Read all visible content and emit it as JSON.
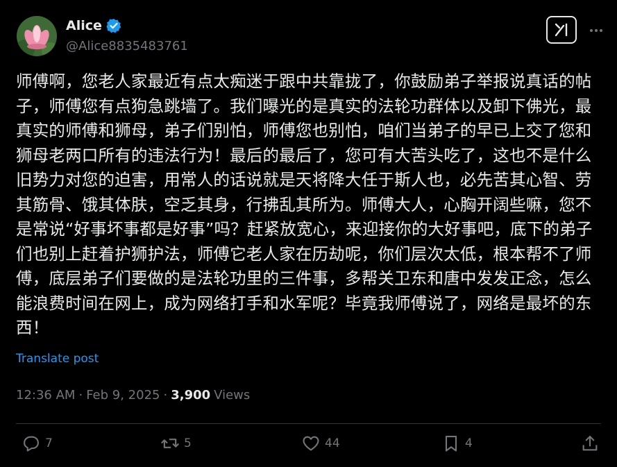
{
  "author": {
    "name": "Alice",
    "handle": "@Alice8835483761",
    "verified": true
  },
  "post": {
    "text": "师傅啊，您老人家最近有点太痴迷于跟中共靠拢了，你鼓励弟子举报说真话的帖子，师傅您有点狗急跳墙了。我们曝光的是真实的法轮功群体以及卸下佛光，最真实的师傅和狮母，弟子们别怕，师傅您也别怕，咱们当弟子的早已上交了您和狮母老两口所有的违法行为！最后的最后了，您可有大苦头吃了，这也不是什么旧势力对您的迫害，用常人的话说就是天将降大任于斯人也，必先苦其心智、劳其筋骨、饿其体肤，空乏其身，行拂乱其所为。师傅大人，心胸开阔些嘛，您不是常说“好事坏事都是好事”吗？赶紧放宽心，来迎接你的大好事吧，底下的弟子们也别上赶着护狮护法，师傅它老人家在历劫呢，你们层次太低，根本帮不了师傅，底层弟子们要做的是法轮功里的三件事，多帮关卫东和唐中发发正念，怎么能浪费时间在网上，成为网络打手和水军呢？毕竟我师傅说了，网络是最坏的东西！",
    "translate_label": "Translate post",
    "time": "12:36 AM",
    "separator": "·",
    "date": "Feb 9, 2025",
    "views_count": "3,900",
    "views_label": "Views"
  },
  "actions": {
    "replies": "7",
    "reposts": "5",
    "likes": "44",
    "bookmarks": "4"
  },
  "colors": {
    "background": "#000000",
    "text": "#e7e9ea",
    "muted": "#71767b",
    "accent": "#1d9bf0",
    "divider": "#2f3336"
  },
  "icons": {
    "avatar": "lotus-flower-avatar",
    "verified": "verified-badge-icon",
    "grok": "grok-icon",
    "more": "more-icon",
    "reply": "reply-icon",
    "repost": "repost-icon",
    "like": "like-icon",
    "bookmark": "bookmark-icon",
    "share": "share-icon"
  }
}
